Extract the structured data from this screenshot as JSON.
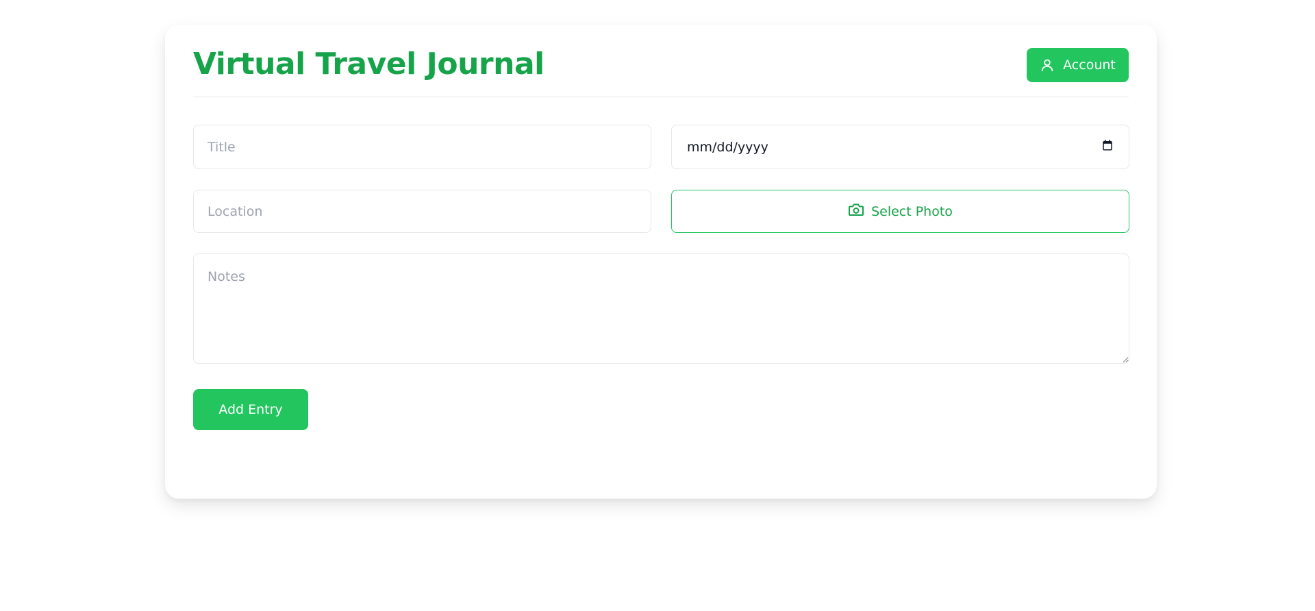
{
  "app": {
    "title": "Virtual Travel Journal"
  },
  "header": {
    "account_label": "Account"
  },
  "form": {
    "title_placeholder": "Title",
    "date_placeholder": "mm/dd/yyyy",
    "location_placeholder": "Location",
    "photo_label": "Select Photo",
    "notes_placeholder": "Notes",
    "submit_label": "Add Entry"
  },
  "icons": {
    "account": "user-icon",
    "date": "calendar-icon",
    "photo": "camera-icon"
  },
  "colors": {
    "brand_green": "#22c55e",
    "brand_green_dark": "#16a34a",
    "border": "#e5e7eb",
    "placeholder": "#9ca3af"
  }
}
